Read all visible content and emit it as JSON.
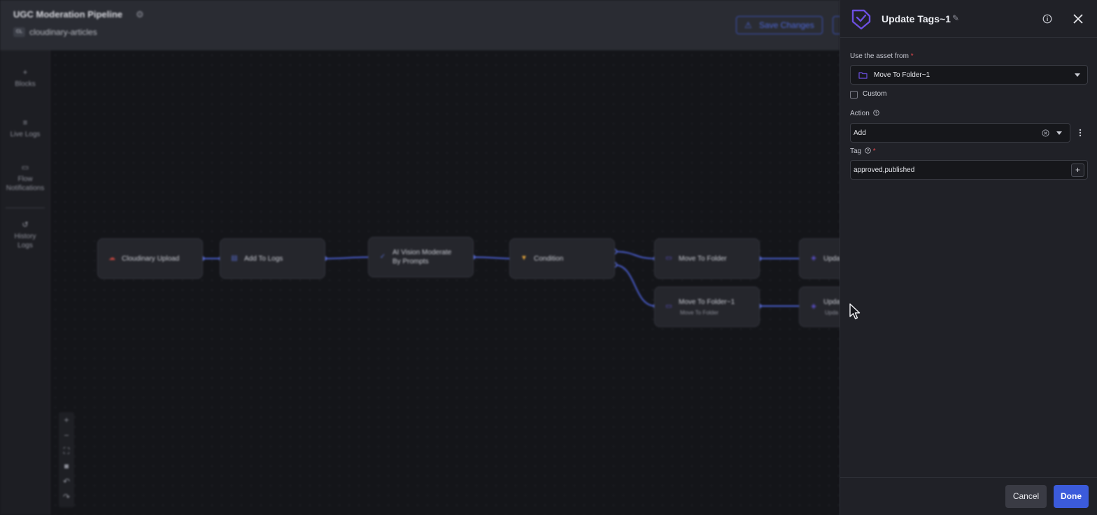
{
  "flow": {
    "title": "UGC Moderation Pipeline",
    "env_badge": "CL",
    "env_name": "cloudinary-articles",
    "save_label": "Save Changes"
  },
  "sidebar": {
    "items": [
      {
        "label": "Blocks",
        "icon": "plus-icon"
      },
      {
        "label": "Live Logs",
        "icon": "list-icon"
      },
      {
        "label": "Flow Notifications",
        "icon": "book-icon"
      },
      {
        "label": "History Logs",
        "icon": "history-icon"
      }
    ]
  },
  "canvas": {
    "nodes": [
      {
        "label": "Cloudinary Upload",
        "icon": "cloud-upload-icon",
        "icon_color": "#c2453f"
      },
      {
        "label": "Add To Logs",
        "icon": "logs-icon",
        "icon_color": "#5468c8"
      },
      {
        "label": "AI Vision Moderate",
        "label2": "By Prompts",
        "icon": "check-icon",
        "icon_color": "#5468c8"
      },
      {
        "label": "Condition",
        "icon": "filter-icon",
        "icon_color": "#e0a23a"
      },
      {
        "label": "Move To Folder",
        "icon": "folder-icon",
        "icon_color": "#5a4fc8"
      },
      {
        "label": "Upda",
        "icon": "tag-icon",
        "icon_color": "#5a4fc8"
      },
      {
        "label": "Move To Folder~1",
        "sub": "Move To Folder",
        "icon": "folder-icon",
        "icon_color": "#5a4fc8"
      },
      {
        "label": "Upda",
        "sub": "Upda",
        "icon": "tag-icon",
        "icon_color": "#5a4fc8"
      }
    ],
    "edge_color": "#4a5ed0"
  },
  "panel": {
    "title": "Update Tags~1",
    "asset_label": "Use the asset from",
    "asset_value": "Move To Folder~1",
    "custom_label": "Custom",
    "custom_checked": false,
    "action_label": "Action",
    "action_value": "Add",
    "tag_label": "Tag",
    "tag_value": "approved,published",
    "cancel_label": "Cancel",
    "done_label": "Done",
    "accent": "#3b5bdb",
    "brand": "#6c4fe0"
  }
}
